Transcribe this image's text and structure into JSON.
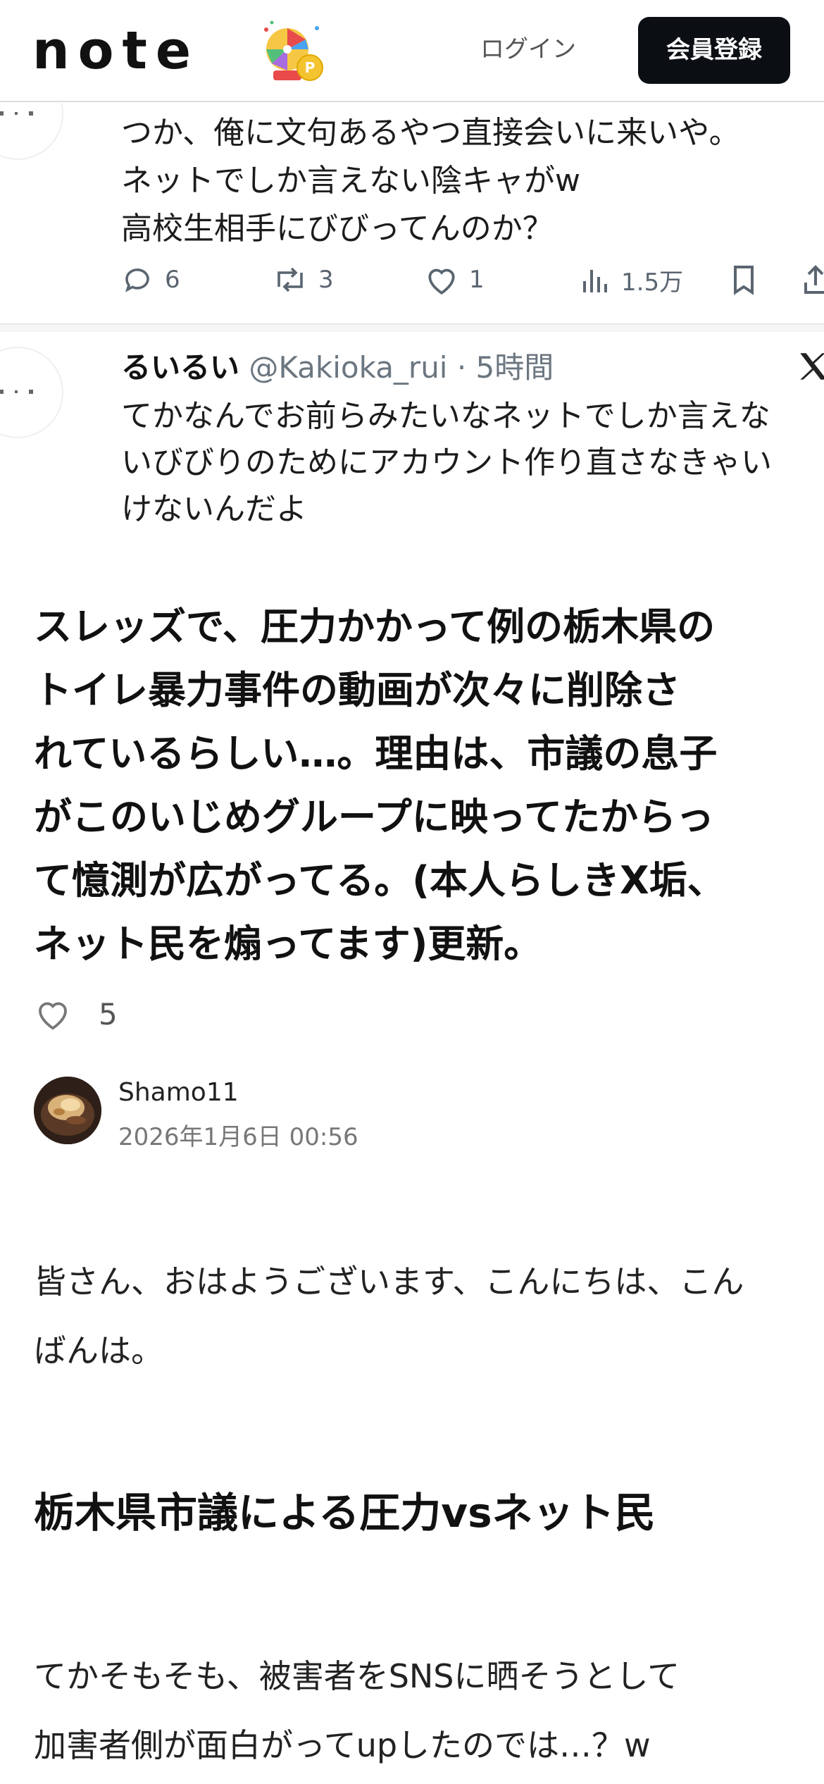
{
  "header": {
    "logo_text": "note",
    "login_label": "ログイン",
    "signup_label": "会員登録"
  },
  "embed": {
    "tweet1": {
      "lines": [
        "つか、俺に文句あるやつ直接会いに来いや。",
        "ネットでしか言えない陰キャがw",
        "高校生相手にびびってんのか？"
      ],
      "replies": "6",
      "reposts": "3",
      "likes": "1",
      "views": "1.5万"
    },
    "tweet2": {
      "name": "るいるい",
      "handle_time": "@Kakioka_rui · 5時間",
      "lines": [
        "てかなんでお前らみたいなネットでしか言えな",
        "いびびりのためにアカウント作り直さなきゃい",
        "けないんだよ"
      ]
    }
  },
  "article": {
    "title_lines": [
      "スレッズで、圧力かかって例の栃木県の",
      "トイレ暴力事件の動画が次々に削除さ",
      "れているらしい…。理由は、市議の息子",
      "がこのいじめグループに映ってたからっ",
      "て憶測が広がってる。(本人らしきX垢、",
      "ネット民を煽ってます)更新。"
    ],
    "like_count": "5",
    "author_name": "Shamo11",
    "published": "2026年1月6日 00:56",
    "intro_lines": [
      "皆さん、おはようございます、こんにちは、こん",
      "ばんは。"
    ],
    "section_heading": "栃木県市議による圧力vsネット民",
    "paragraph_lines": [
      "てかそもそも、被害者をSNSに晒そうとして",
      "加害者側が面白がってupしたのでは…？w"
    ]
  },
  "colors": {
    "signup_bg": "#0b0f14",
    "text_primary": "#111111",
    "text_muted": "#777777",
    "tweet_action": "#5a6570"
  }
}
